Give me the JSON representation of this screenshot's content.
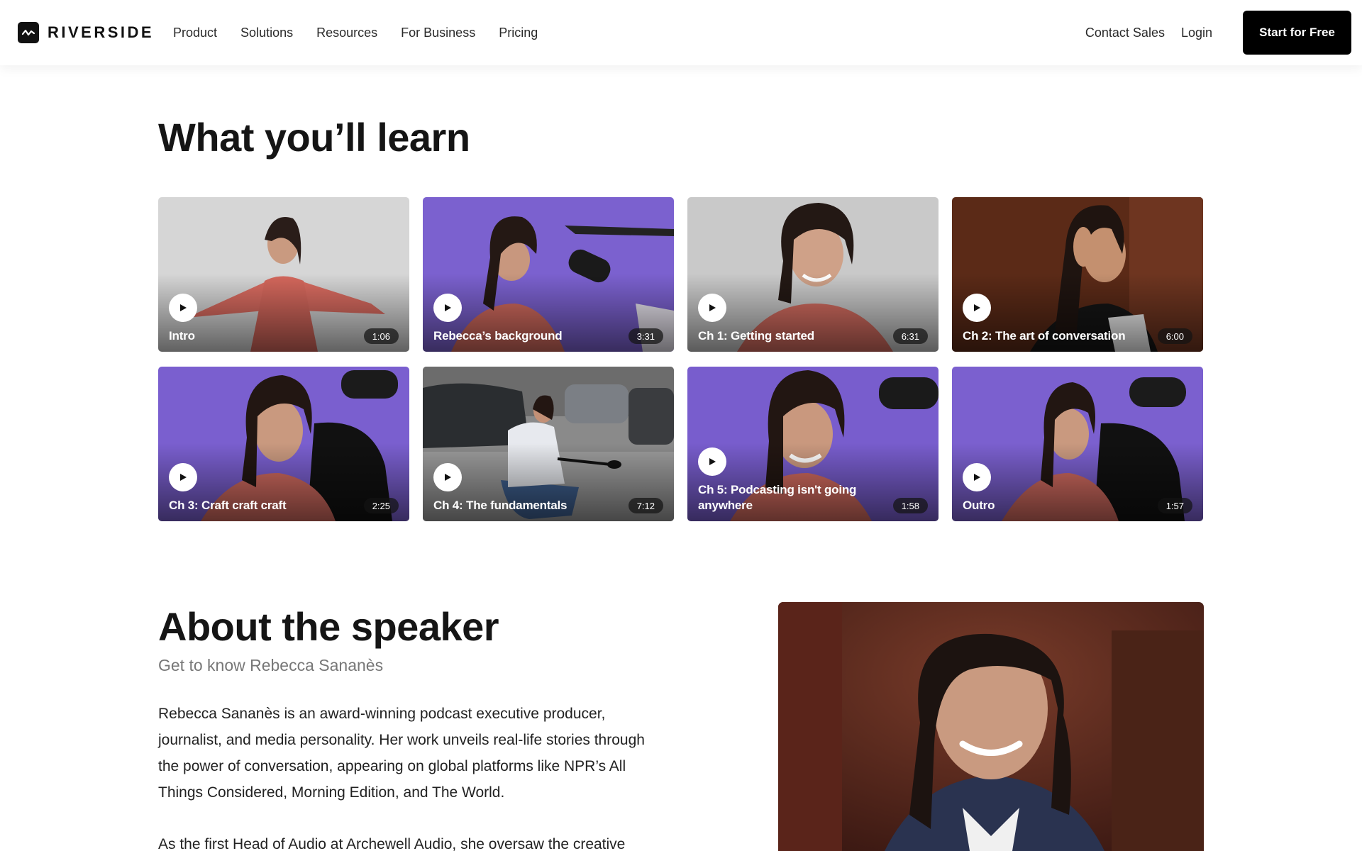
{
  "nav": {
    "brand": "RIVERSIDE",
    "links": [
      "Product",
      "Solutions",
      "Resources",
      "For Business",
      "Pricing"
    ],
    "contact_sales": "Contact Sales",
    "login": "Login",
    "cta": "Start for Free"
  },
  "learn": {
    "heading": "What you’ll learn",
    "videos": [
      {
        "title": "Intro",
        "duration": "1:06"
      },
      {
        "title": "Rebecca’s background",
        "duration": "3:31"
      },
      {
        "title": "Ch 1: Getting started",
        "duration": "6:31"
      },
      {
        "title": "Ch 2: The art of conversation",
        "duration": "6:00"
      },
      {
        "title": "Ch 3: Craft craft craft",
        "duration": "2:25"
      },
      {
        "title": "Ch 4: The fundamentals",
        "duration": "7:12"
      },
      {
        "title": "Ch 5: Podcasting isn't going anywhere",
        "duration": "1:58"
      },
      {
        "title": "Outro",
        "duration": "1:57"
      }
    ]
  },
  "speaker": {
    "heading": "About the speaker",
    "subheading": "Get to know Rebecca Sananès",
    "paragraph_1": "Rebecca Sananès is an award-winning podcast executive producer, journalist, and media personality. Her work unveils real-life stories through the power of conversation, appearing on global platforms like NPR’s All Things Considered, Morning Edition, and The World.",
    "paragraph_2": "As the first Head of Audio at Archewell Audio, she oversaw the creative"
  },
  "icons": {
    "logo": "waveform-logo-icon",
    "play": "play-icon"
  },
  "colors": {
    "cta_background": "#000000",
    "thumb_purple": "#7a5fd0",
    "thumb_grey": "#cfcfcf",
    "thumb_brown": "#5a2a18",
    "shirt_coral": "#d8685e"
  }
}
